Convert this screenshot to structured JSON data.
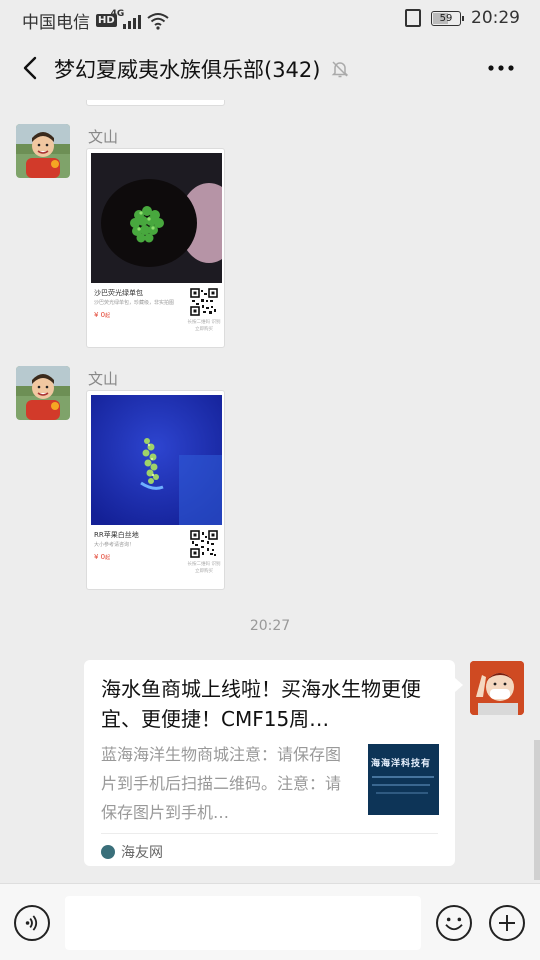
{
  "status_bar": {
    "carrier": "中国电信",
    "hd": "HD",
    "network": "4G",
    "battery": "59",
    "time": "20:29"
  },
  "nav": {
    "title": "梦幻夏威夷水族俱乐部(342)",
    "back_icon": "chevron-left-icon",
    "mute_icon": "bell-off-icon",
    "more_icon": "more-dots-icon"
  },
  "messages": [
    {
      "sender": "文山",
      "image_card": {
        "title": "沙巴荧光绿单包",
        "subtitle": "沙巴荧光绿单包，珍藏级，非实拍图",
        "price": "¥ 0",
        "price_unit": "起",
        "qr_caption": "长按二维码 识别立即购买"
      }
    },
    {
      "sender": "文山",
      "image_card": {
        "title": "RR苹果白丝地",
        "subtitle": "大小参考请咨询！",
        "price": "¥ 0",
        "price_unit": "起",
        "qr_caption": "长按二维码 识别立即购买"
      }
    }
  ],
  "timestamp": "20:27",
  "link_card": {
    "title": "海水鱼商城上线啦！买海水生物更便宜、更便捷！CMF15周…",
    "description": "蓝海海洋生物商城注意：请保存图片到手机后扫描二维码。注意：请保存图片到手机…",
    "thumb_text": "海海洋科技有",
    "source": "海友网"
  },
  "input_bar": {
    "voice_icon": "voice-icon",
    "emoji_icon": "emoji-icon",
    "plus_icon": "plus-icon",
    "placeholder": ""
  },
  "colors": {
    "background": "#ededed",
    "card": "#ffffff",
    "price": "#e2402e",
    "meta_text": "#999999"
  }
}
